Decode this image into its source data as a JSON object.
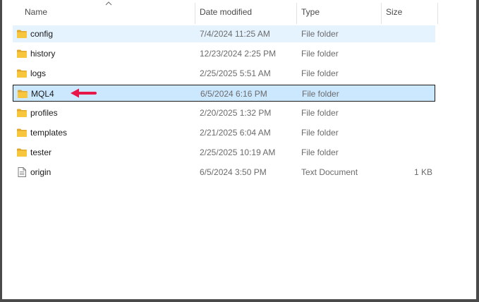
{
  "columns": {
    "name": "Name",
    "date_modified": "Date modified",
    "type": "Type",
    "size": "Size"
  },
  "sort": {
    "column": "name",
    "direction": "ascending"
  },
  "colors": {
    "folder": "#f8c63d",
    "selection_bg": "#cce8ff",
    "hover_bg": "#e5f3ff",
    "annotation_arrow": "#e8174a"
  },
  "files": [
    {
      "name": "config",
      "date": "7/4/2024 11:25 AM",
      "type": "File folder",
      "size": "",
      "icon": "folder-icon",
      "state": "hover"
    },
    {
      "name": "history",
      "date": "12/23/2024 2:25 PM",
      "type": "File folder",
      "size": "",
      "icon": "folder-icon"
    },
    {
      "name": "logs",
      "date": "2/25/2025 5:51 AM",
      "type": "File folder",
      "size": "",
      "icon": "folder-icon"
    },
    {
      "name": "MQL4",
      "date": "6/5/2024 6:16 PM",
      "type": "File folder",
      "size": "",
      "icon": "folder-icon",
      "state": "selected"
    },
    {
      "name": "profiles",
      "date": "2/20/2025 1:32 PM",
      "type": "File folder",
      "size": "",
      "icon": "folder-icon"
    },
    {
      "name": "templates",
      "date": "2/21/2025 6:04 AM",
      "type": "File folder",
      "size": "",
      "icon": "folder-icon"
    },
    {
      "name": "tester",
      "date": "2/25/2025 10:19 AM",
      "type": "File folder",
      "size": "",
      "icon": "folder-icon"
    },
    {
      "name": "origin",
      "date": "6/5/2024 3:50 PM",
      "type": "Text Document",
      "size": "1 KB",
      "icon": "text-file-icon"
    }
  ]
}
